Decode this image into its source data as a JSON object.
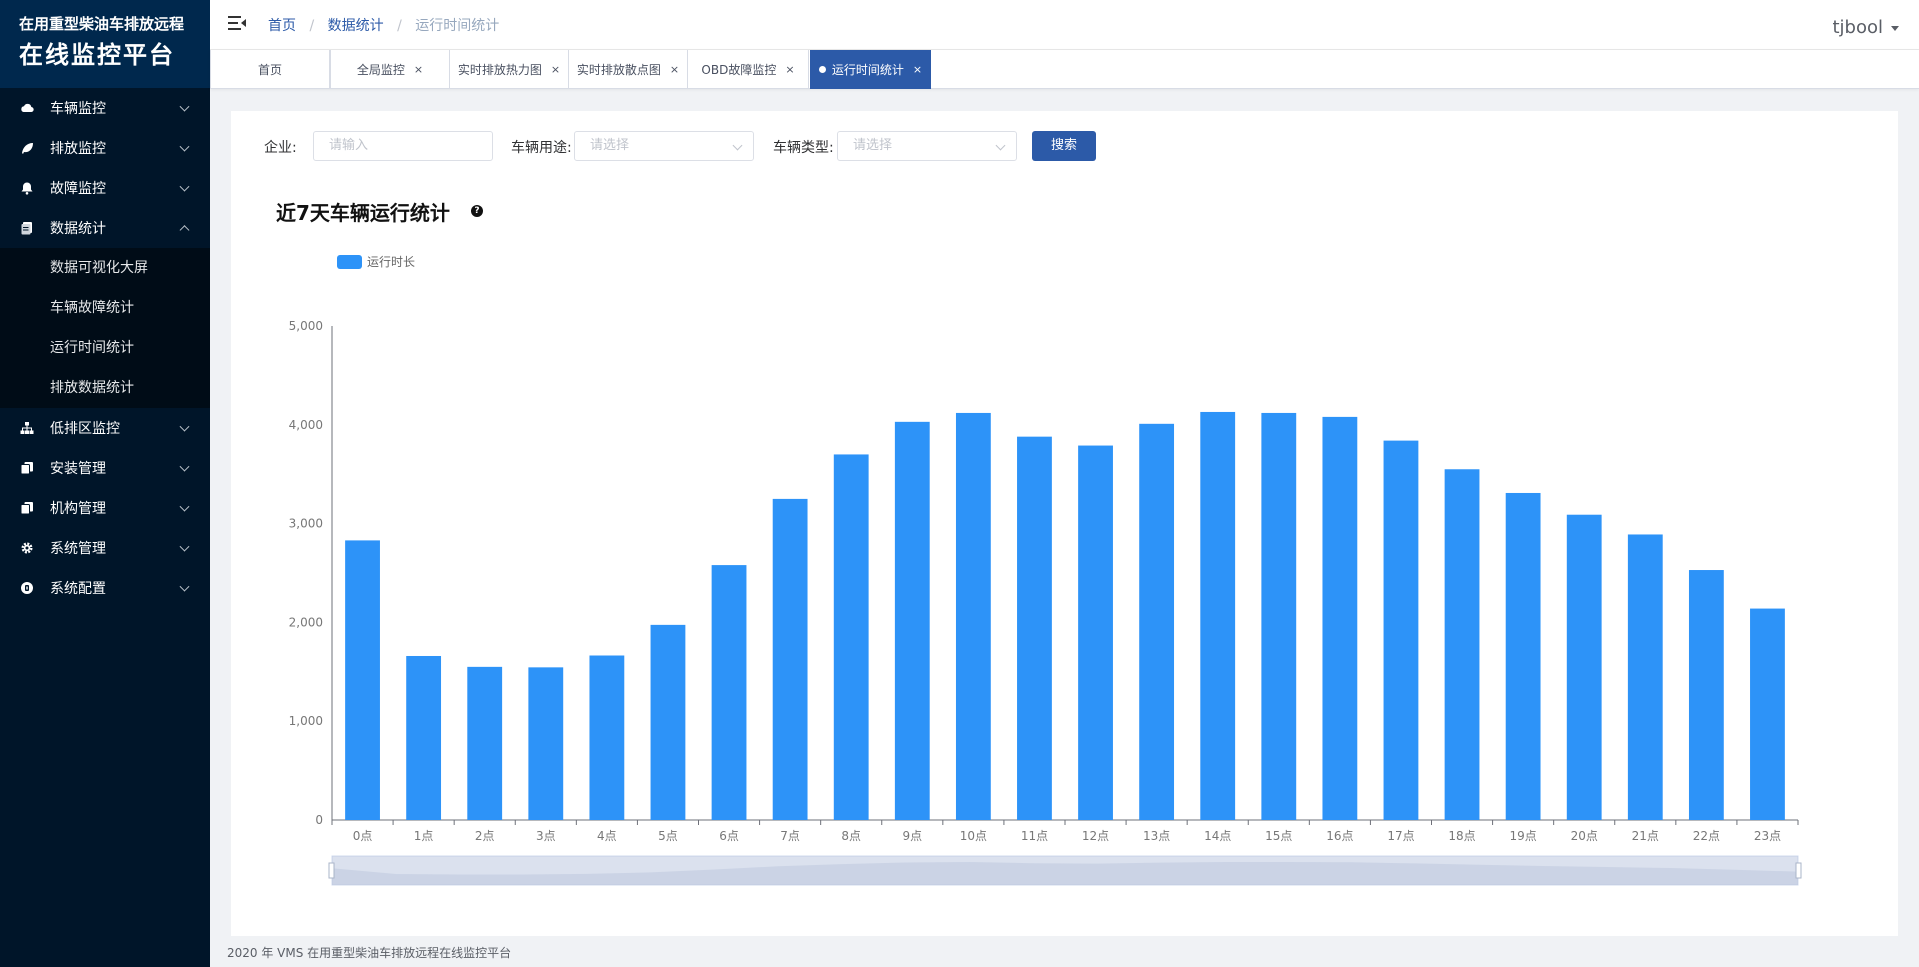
{
  "app": {
    "logo_line1": "在用重型柴油车排放远程",
    "logo_line2": "在线监控平台"
  },
  "sidebar": {
    "items": [
      {
        "label": "车辆监控",
        "icon": "cloud-icon"
      },
      {
        "label": "排放监控",
        "icon": "leaf-icon"
      },
      {
        "label": "故障监控",
        "icon": "bell-icon"
      },
      {
        "label": "数据统计",
        "icon": "document-icon",
        "expanded": true,
        "children": [
          "数据可视化大屏",
          "车辆故障统计",
          "运行时间统计",
          "排放数据统计"
        ]
      },
      {
        "label": "低排区监控",
        "icon": "sitemap-icon"
      },
      {
        "label": "安装管理",
        "icon": "copy-icon"
      },
      {
        "label": "机构管理",
        "icon": "copy-icon"
      },
      {
        "label": "系统管理",
        "icon": "gear-icon"
      },
      {
        "label": "系统配置",
        "icon": "settings-circle-icon"
      }
    ]
  },
  "header": {
    "breadcrumb": [
      "首页",
      "数据统计",
      "运行时间统计"
    ],
    "user": "tjbool"
  },
  "tabs": [
    {
      "label": "首页",
      "closable": false
    },
    {
      "label": "全局监控",
      "closable": true
    },
    {
      "label": "实时排放热力图",
      "closable": true
    },
    {
      "label": "实时排放散点图",
      "closable": true
    },
    {
      "label": "OBD故障监控",
      "closable": true
    },
    {
      "label": "运行时间统计",
      "closable": true,
      "active": true
    }
  ],
  "tab_close_glyph": "×",
  "filters": {
    "company_label": "企业:",
    "company_placeholder": "请输入",
    "usage_label": "车辆用途:",
    "usage_placeholder": "请选择",
    "type_label": "车辆类型:",
    "type_placeholder": "请选择",
    "search_label": "搜索"
  },
  "chart_title": "近7天车辆运行统计",
  "help_glyph": "?",
  "chart_data": {
    "type": "bar",
    "legend": [
      "运行时长"
    ],
    "categories": [
      "0点",
      "1点",
      "2点",
      "3点",
      "4点",
      "5点",
      "6点",
      "7点",
      "8点",
      "9点",
      "10点",
      "11点",
      "12点",
      "13点",
      "14点",
      "15点",
      "16点",
      "17点",
      "18点",
      "19点",
      "20点",
      "21点",
      "22点",
      "23点"
    ],
    "series": [
      {
        "name": "运行时长",
        "values": [
          2830,
          1660,
          1550,
          1545,
          1665,
          1975,
          2580,
          3250,
          3700,
          4030,
          4120,
          3880,
          3790,
          4010,
          4130,
          4120,
          4080,
          3840,
          3550,
          3310,
          3090,
          2890,
          2530,
          2140
        ]
      }
    ],
    "yticks": [
      "0",
      "1,000",
      "2,000",
      "3,000",
      "4,000",
      "5,000"
    ],
    "ylim": [
      0,
      5000
    ],
    "bar_color": "#2d93f8",
    "datazoom": true
  },
  "footer": "2020 年 VMS 在用重型柴油车排放远程在线监控平台"
}
